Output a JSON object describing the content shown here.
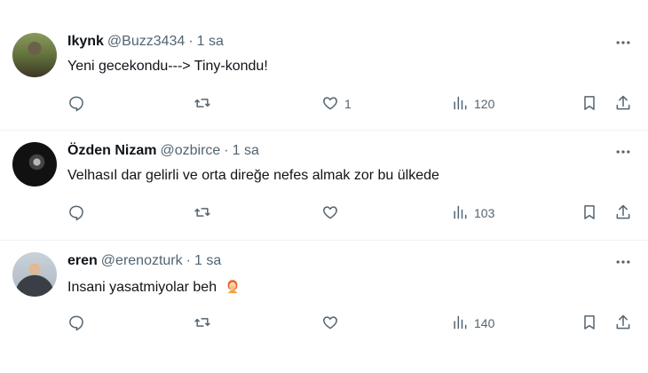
{
  "colors": {
    "text_primary": "#0f1419",
    "text_secondary": "#536471",
    "divider": "#eff3f4"
  },
  "replies": [
    {
      "name": "Ikynk",
      "handle": "@Buzz3434",
      "separator": "·",
      "time": "1 sa",
      "text": "Yeni gecekondu---> Tiny-kondu!",
      "likes": "1",
      "views": "120"
    },
    {
      "name": "Özden Nizam",
      "handle": "@ozbirce",
      "separator": "·",
      "time": "1 sa",
      "text": "Velhasıl dar gelirli ve orta direğe nefes almak zor bu ülkede",
      "likes": "",
      "views": "103"
    },
    {
      "name": "eren",
      "handle": "@erenozturk",
      "separator": "·",
      "time": "1 sa",
      "text": "Insani yasatmiyolar beh",
      "emoji": "face-palm-emoji",
      "likes": "",
      "views": "140"
    }
  ],
  "icons": {
    "more": "more-horizontal-icon",
    "reply": "reply-icon",
    "retweet": "retweet-icon",
    "like": "heart-icon",
    "views": "views-icon",
    "bookmark": "bookmark-icon",
    "share": "share-icon"
  }
}
